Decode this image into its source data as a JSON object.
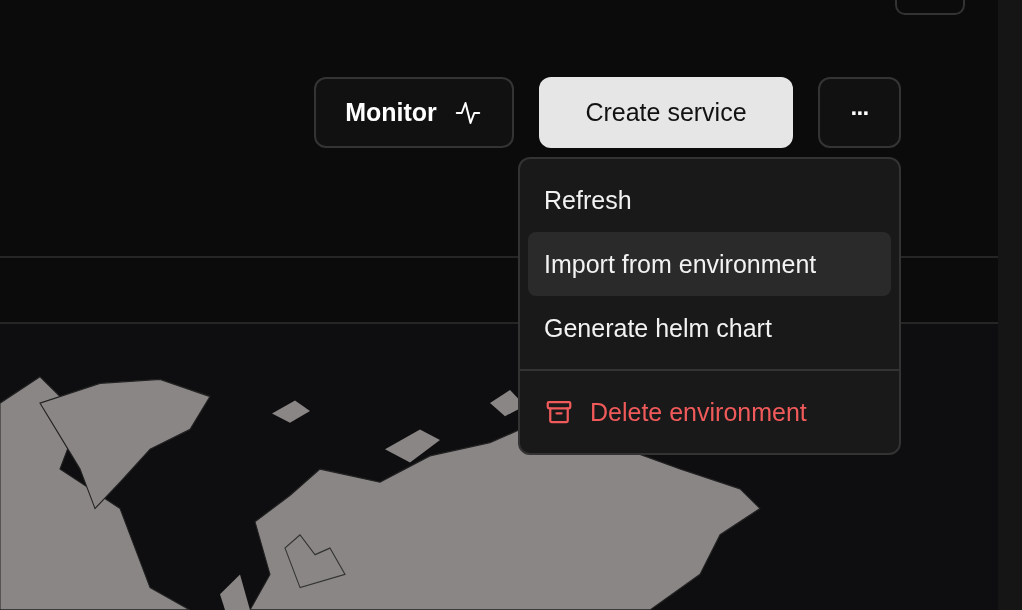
{
  "toolbar": {
    "buttons": [
      {
        "label": "Monitor",
        "kind": "outline"
      },
      {
        "label": "Create service",
        "kind": "primary"
      },
      {
        "label": "···",
        "kind": "more"
      }
    ]
  },
  "menu": {
    "items": [
      {
        "label": "Refresh",
        "kind": "normal",
        "selected": false
      },
      {
        "label": "Import from environment",
        "kind": "normal",
        "selected": true
      },
      {
        "label": "Generate helm chart",
        "kind": "normal",
        "selected": false
      },
      {
        "label": "Delete environment",
        "kind": "danger",
        "selected": false
      }
    ]
  }
}
